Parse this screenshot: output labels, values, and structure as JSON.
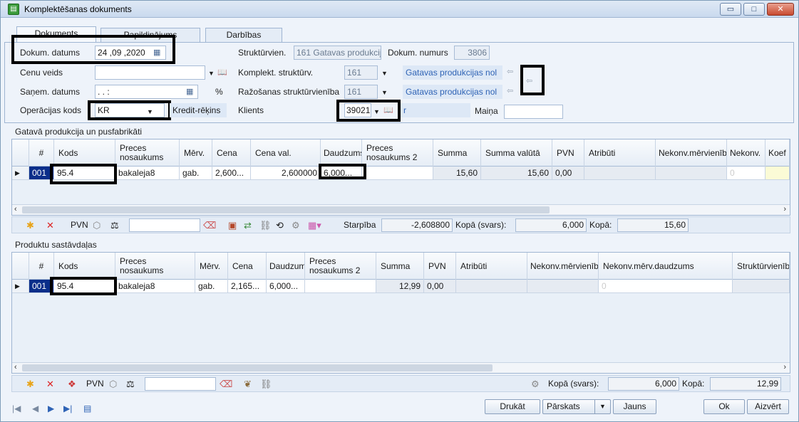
{
  "window": {
    "title": "Komplektēšanas dokuments",
    "app_icon": "document-icon",
    "min_label": "▭",
    "max_label": "□",
    "close_label": "✕"
  },
  "tabs": [
    {
      "label": "Dokuments",
      "active": true
    },
    {
      "label": "Papildinājums",
      "active": false
    },
    {
      "label": "Darbības",
      "active": false
    }
  ],
  "form": {
    "dokum_datums_label": "Dokum. datums",
    "dokum_datums_value": "24 ,09 ,2020",
    "cenu_veids_label": "Cenu veids",
    "cenu_veids_value": "",
    "sanem_datums_label": "Saņem. datums",
    "sanem_datums_value": ".      .                  :",
    "percent_label": "%",
    "operacijas_kods_label": "Operācijas kods",
    "operacijas_kods_value": "KR",
    "operacijas_kods_desc": "Kredit-rēķins",
    "strukturvien_label": "Struktūrvien.",
    "strukturvien_value": "161 Gatavas produkcij",
    "dokum_numurs_label": "Dokum. numurs",
    "dokum_numurs_value": "3806",
    "komplekt_label": "Komplekt. struktūrv.",
    "komplekt_value": "161",
    "komplekt_desc": "Gatavas produkcijas nol",
    "razosanas_label": "Ražošanas struktūrvienība",
    "razosanas_value": "161",
    "razosanas_desc": "Gatavas produkcijas nol",
    "klienti_label": "Klients",
    "klienti_value": "39021",
    "klienti_desc": "r",
    "maina_label": "Maiņa",
    "maina_value": ""
  },
  "grid1": {
    "section_title": "Gatavā produkcija un pusfabrikāti",
    "columns": [
      "#",
      "Kods",
      "Preces nosaukums",
      "Mērv.",
      "Cena",
      "Cena val.",
      "Daudzums",
      "Preces nosaukums 2",
      "Summa",
      "Summa valūtā",
      "PVN",
      "Atribūti",
      "Nekonv.mērvienība",
      "Nekonv.",
      "Koef"
    ],
    "rows": [
      {
        "num": "001",
        "kods": "95.4",
        "nosaukums": "bakaleja8",
        "merv": "gab.",
        "cena": "2,600...",
        "cena_val": "2,600000",
        "daudzums": "6,000...",
        "nosaukums2": "",
        "summa": "15,60",
        "summa_val": "15,60",
        "pvn": "0,00",
        "atributi": "",
        "nekonv_merv": "",
        "nekonv": "0",
        "koef": ""
      }
    ]
  },
  "toolbar1": {
    "pvn_label": "PVN",
    "search_value": "",
    "starpiba_label": "Starpība",
    "starpiba_value": "-2,608800",
    "kopa_svars_label": "Kopā (svars):",
    "kopa_svars_value": "6,000",
    "kopa_label": "Kopā:",
    "kopa_value": "15,60"
  },
  "grid2": {
    "section_title": "Produktu sastāvdaļas",
    "columns": [
      "#",
      "Kods",
      "Preces nosaukums",
      "Mērv.",
      "Cena",
      "Daudzums",
      "Preces nosaukums 2",
      "Summa",
      "PVN",
      "Atribūti",
      "Nekonv.mērvienība",
      "Nekonv.mērv.daudzums",
      "Struktūrvienība"
    ],
    "rows": [
      {
        "num": "001",
        "kods": "95.4",
        "nosaukums": "bakaleja8",
        "merv": "gab.",
        "cena": "2,165...",
        "daudzums": "6,000...",
        "nosaukums2": "",
        "summa": "12,99",
        "pvn": "0,00",
        "atributi": "",
        "nekonv_merv": "",
        "nekonv_daudz": "0",
        "struktur": ""
      }
    ]
  },
  "toolbar2": {
    "pvn_label": "PVN",
    "search_value": "",
    "kopa_svars_label": "Kopā (svars):",
    "kopa_svars_value": "6,000",
    "kopa_label": "Kopā:",
    "kopa_value": "12,99"
  },
  "buttons": {
    "drukat": "Drukāt",
    "parskats": "Pārskats",
    "jauns": "Jauns",
    "ok": "Ok",
    "aizvert": "Aizvērt"
  },
  "nav": {
    "first": "|◀",
    "prev": "◀",
    "next": "▶",
    "last": "▶|",
    "doc": "▤"
  },
  "colors": {
    "accent": "#2f63b5",
    "selection": "#0b2e8a",
    "highlight_box": "#000000"
  }
}
